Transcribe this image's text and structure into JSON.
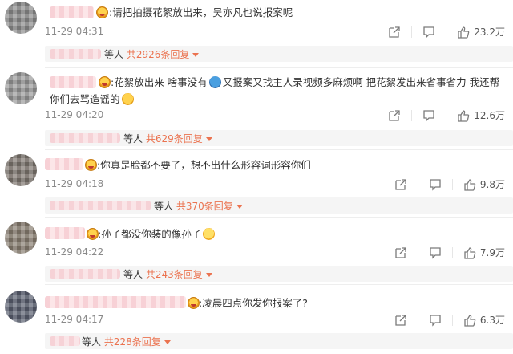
{
  "colors": {
    "link": "#eb7350",
    "text": "#333333",
    "muted": "#8a8a8a",
    "blur": "#f6c9cf"
  },
  "icons": {
    "share": "share-icon",
    "comment": "comment-icon",
    "like": "thumbs-up-icon",
    "vip": "vip-badge-icon"
  },
  "comments": [
    {
      "text": ":请把拍摄花絮放出来，吴亦凡也说报案呢",
      "time": "11-29 04:31",
      "likes": "23.2万",
      "reply_prefix": "等人",
      "reply_count": "共2926条回复"
    },
    {
      "text_a": ":花絮放出来 啥事没有",
      "text_b": "又报案又找主人录视频多麻烦啊 把花絮发出来省事省力 我还帮你们去骂造谣的",
      "time": "11-29 04:20",
      "likes": "12.6万",
      "reply_prefix": "等人",
      "reply_count": "共629条回复"
    },
    {
      "text": ":你真是脸都不要了，想不出什么形容词形容你们",
      "time": "11-29 04:18",
      "likes": "9.8万",
      "reply_prefix": "等人",
      "reply_count": "共370条回复"
    },
    {
      "text": ":孙子都没你装的像孙子",
      "time": "11-29 04:22",
      "likes": "7.9万",
      "reply_prefix": "等人",
      "reply_count": "共243条回复"
    },
    {
      "text": ":凌晨四点你发你报案了?",
      "time": "11-29 04:17",
      "likes": "6.3万",
      "reply_prefix": "等人",
      "reply_count": "共228条回复"
    }
  ]
}
